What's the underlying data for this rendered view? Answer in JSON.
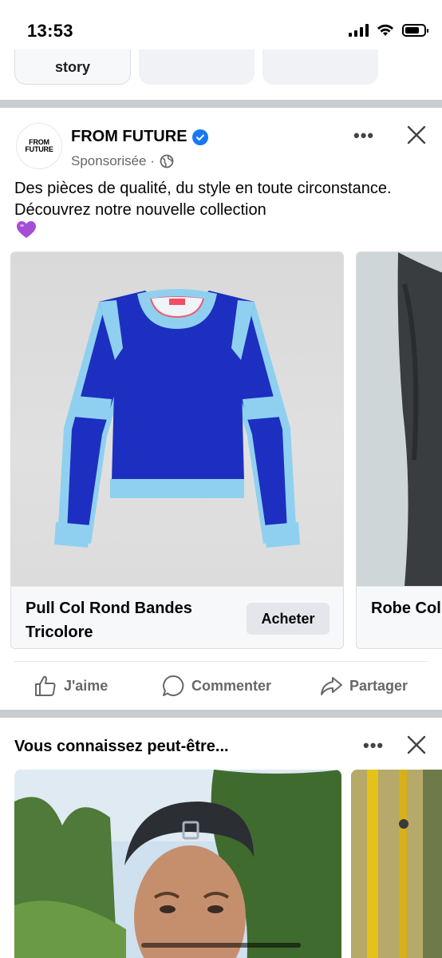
{
  "status_bar": {
    "time": "13:53"
  },
  "stories": {
    "first_label": "story"
  },
  "post": {
    "page_name": "FROM FUTURE",
    "avatar_text_line1": "FROM",
    "avatar_text_line2": "FUTURE",
    "sponsored_label": "Sponsorisée ·",
    "text": "Des pièces de qualité, du style en toute circonstance. Découvrez notre nouvelle collection",
    "more_label": "•••",
    "carousel": [
      {
        "title": "Pull Col Rond Bandes Tricolore",
        "button": "Acheter"
      },
      {
        "title": "Robe Col Longue C"
      }
    ],
    "actions": {
      "like": "J'aime",
      "comment": "Commenter",
      "share": "Partager"
    }
  },
  "pymk": {
    "title": "Vous connaissez peut-être...",
    "more_label": "•••"
  },
  "colors": {
    "accent": "#1877f2",
    "sweater_blue": "#1d2fc0",
    "sweater_light": "#8fd0f0",
    "divider": "#c9ccd1"
  }
}
